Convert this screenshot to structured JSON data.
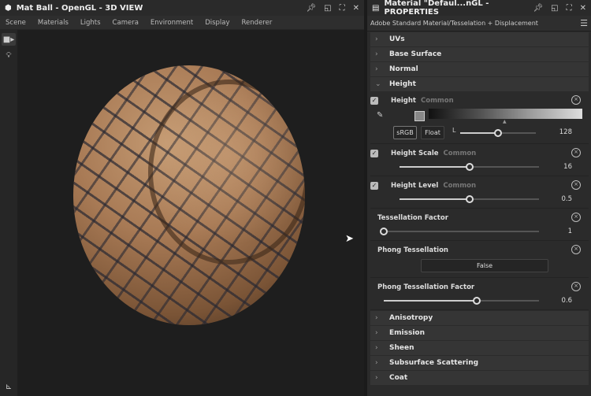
{
  "view3d": {
    "title": "Mat Ball - OpenGL - 3D VIEW",
    "menu": [
      "Scene",
      "Materials",
      "Lights",
      "Camera",
      "Environment",
      "Display",
      "Renderer"
    ]
  },
  "props": {
    "title": "Material \"Defaul...nGL - PROPERTIES",
    "subtitle": "Adobe Standard Material/Tesselation + Displacement",
    "sections_top": [
      "UVs",
      "Base Surface",
      "Normal",
      "Height"
    ],
    "height": {
      "label": "Height",
      "tag": "Common",
      "srgb": "sRGB",
      "float": "Float",
      "l_label": "L",
      "value": "128",
      "slider_fraction": 0.5
    },
    "height_scale": {
      "label": "Height Scale",
      "tag": "Common",
      "value": "16",
      "slider_fraction": 0.5
    },
    "height_level": {
      "label": "Height Level",
      "tag": "Common",
      "value": "0.5",
      "slider_fraction": 0.5
    },
    "tess_factor": {
      "label": "Tessellation Factor",
      "value": "1",
      "slider_fraction": 0
    },
    "phong_tess": {
      "label": "Phong Tessellation",
      "value": "False"
    },
    "phong_factor": {
      "label": "Phong Tessellation Factor",
      "value": "0.6",
      "slider_fraction": 0.6
    },
    "sections_bottom": [
      "Anisotropy",
      "Emission",
      "Sheen",
      "Subsurface Scattering",
      "Coat"
    ]
  }
}
